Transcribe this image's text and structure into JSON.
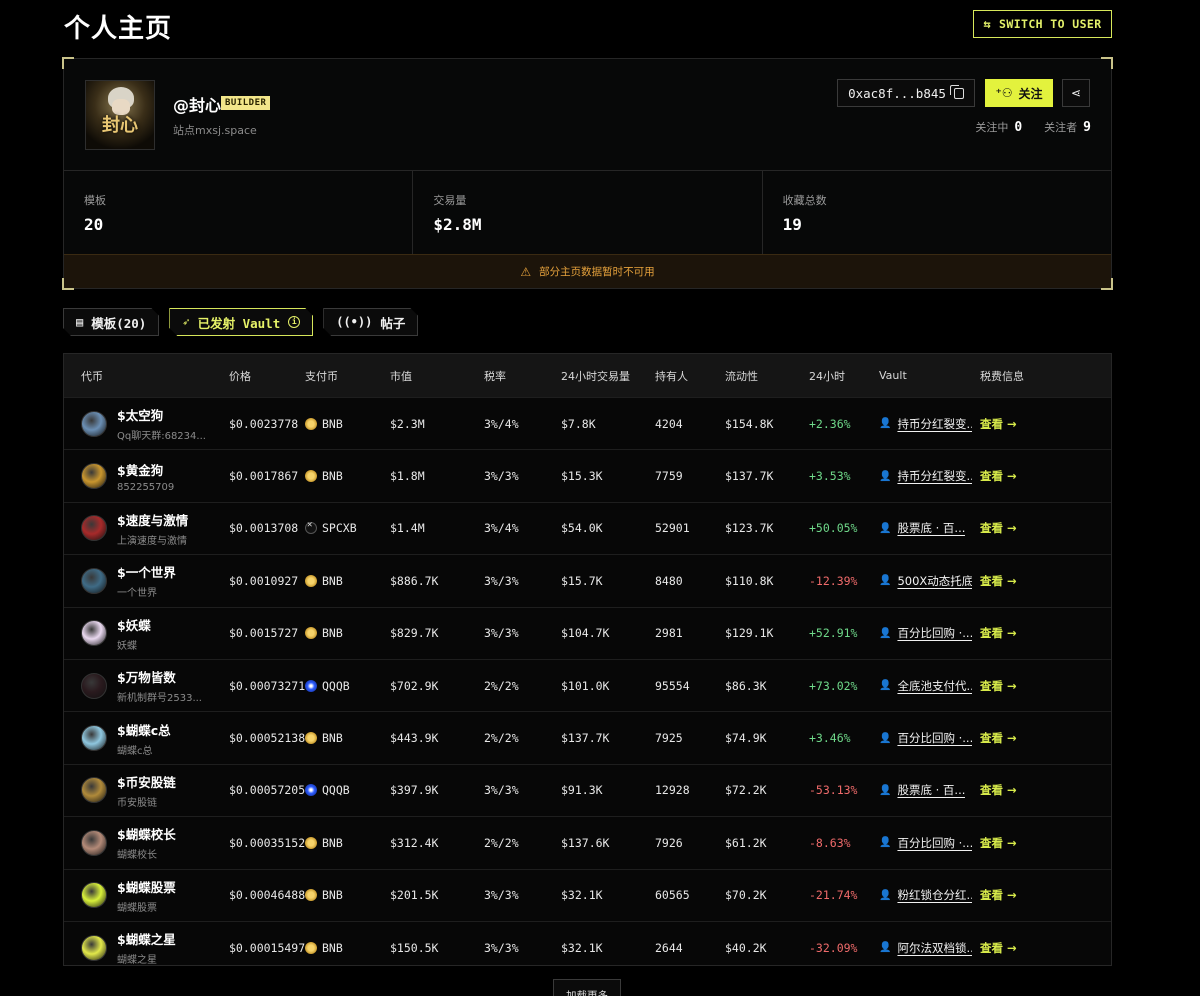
{
  "header": {
    "title": "个人主页",
    "switch_label": "SWITCH TO USER"
  },
  "profile": {
    "avatar_text": "封心",
    "username": "@封心",
    "badge": "BUILDER",
    "site": "站点mxsj.space",
    "address": "0xac8f...b845",
    "follow_label": "关注",
    "following_label": "关注中",
    "following_count": "0",
    "followers_label": "关注者",
    "followers_count": "9"
  },
  "stats": [
    {
      "label": "模板",
      "value": "20"
    },
    {
      "label": "交易量",
      "value": "$2.8M"
    },
    {
      "label": "收藏总数",
      "value": "19"
    }
  ],
  "warning": "部分主页数据暂时不可用",
  "tabs": [
    {
      "label": "模板(20)"
    },
    {
      "label": "已发射 Vault"
    },
    {
      "label": "帖子"
    }
  ],
  "table": {
    "headers": [
      "代币",
      "价格",
      "支付币",
      "市值",
      "税率",
      "24小时交易量",
      "持有人",
      "流动性",
      "24小时",
      "Vault",
      "税费信息"
    ],
    "view_label": "查看 →",
    "rows": [
      {
        "name": "$太空狗",
        "sub": "Qq聊天群:68234...",
        "price": "$0.0023778",
        "pay": "BNB",
        "coin": "bnb",
        "mcap": "$2.3M",
        "tax": "3%/4%",
        "vol": "$7.8K",
        "holders": "4204",
        "liq": "$154.8K",
        "chg": "+2.36%",
        "dir": "up",
        "vault": "持币分红裂变...",
        "icon": "#6b8fb4"
      },
      {
        "name": "$黄金狗",
        "sub": "852255709",
        "price": "$0.0017867",
        "pay": "BNB",
        "coin": "bnb",
        "mcap": "$1.8M",
        "tax": "3%/3%",
        "vol": "$15.3K",
        "holders": "7759",
        "liq": "$137.7K",
        "chg": "+3.53%",
        "dir": "up",
        "vault": "持币分红裂变...",
        "icon": "#c9962e"
      },
      {
        "name": "$速度与激情",
        "sub": "上演速度与激情",
        "price": "$0.0013708",
        "pay": "SPCXB",
        "coin": "spcxb",
        "mcap": "$1.4M",
        "tax": "3%/4%",
        "vol": "$54.0K",
        "holders": "52901",
        "liq": "$123.7K",
        "chg": "+50.05%",
        "dir": "up",
        "vault": "股票底 · 百...",
        "icon": "#a82a2a"
      },
      {
        "name": "$一个世界",
        "sub": "一个世界",
        "price": "$0.0010927",
        "pay": "BNB",
        "coin": "bnb",
        "mcap": "$886.7K",
        "tax": "3%/3%",
        "vol": "$15.7K",
        "holders": "8480",
        "liq": "$110.8K",
        "chg": "-12.39%",
        "dir": "down",
        "vault": "500X动态托底...",
        "icon": "#3f6b86"
      },
      {
        "name": "$妖蝶",
        "sub": "妖蝶",
        "price": "$0.0015727",
        "pay": "BNB",
        "coin": "bnb",
        "mcap": "$829.7K",
        "tax": "3%/3%",
        "vol": "$104.7K",
        "holders": "2981",
        "liq": "$129.1K",
        "chg": "+52.91%",
        "dir": "up",
        "vault": "百分比回购 ·...",
        "icon": "#e9d8ef"
      },
      {
        "name": "$万物皆数",
        "sub": "新机制群号2533...",
        "price": "$0.00073271",
        "pay": "QQQB",
        "coin": "qqqb",
        "mcap": "$702.9K",
        "tax": "2%/2%",
        "vol": "$101.0K",
        "holders": "95554",
        "liq": "$86.3K",
        "chg": "+73.02%",
        "dir": "up",
        "vault": "全底池支付代...",
        "icon": "#2a1a1e"
      },
      {
        "name": "$蝴蝶c总",
        "sub": "蝴蝶c总",
        "price": "$0.00052138",
        "pay": "BNB",
        "coin": "bnb",
        "mcap": "$443.9K",
        "tax": "2%/2%",
        "vol": "$137.7K",
        "holders": "7925",
        "liq": "$74.9K",
        "chg": "+3.46%",
        "dir": "up",
        "vault": "百分比回购 ·...",
        "icon": "#8fc7df"
      },
      {
        "name": "$币安股链",
        "sub": "币安股链",
        "price": "$0.00057205",
        "pay": "QQQB",
        "coin": "qqqb",
        "mcap": "$397.9K",
        "tax": "3%/3%",
        "vol": "$91.3K",
        "holders": "12928",
        "liq": "$72.2K",
        "chg": "-53.13%",
        "dir": "down",
        "vault": "股票底 · 百...",
        "icon": "#b08a3a"
      },
      {
        "name": "$蝴蝶校长",
        "sub": "蝴蝶校长",
        "price": "$0.00035152",
        "pay": "BNB",
        "coin": "bnb",
        "mcap": "$312.4K",
        "tax": "2%/2%",
        "vol": "$137.6K",
        "holders": "7926",
        "liq": "$61.2K",
        "chg": "-8.63%",
        "dir": "down",
        "vault": "百分比回购 ·...",
        "icon": "#b38a78"
      },
      {
        "name": "$蝴蝶股票",
        "sub": "蝴蝶股票",
        "price": "$0.00046488",
        "pay": "BNB",
        "coin": "bnb",
        "mcap": "$201.5K",
        "tax": "3%/3%",
        "vol": "$32.1K",
        "holders": "60565",
        "liq": "$70.2K",
        "chg": "-21.74%",
        "dir": "down",
        "vault": "粉红锁仓分红...",
        "icon": "#d8f03a"
      },
      {
        "name": "$蝴蝶之星",
        "sub": "蝴蝶之星",
        "price": "$0.00015497",
        "pay": "BNB",
        "coin": "bnb",
        "mcap": "$150.5K",
        "tax": "3%/3%",
        "vol": "$32.1K",
        "holders": "2644",
        "liq": "$40.2K",
        "chg": "-32.09%",
        "dir": "down",
        "vault": "阿尔法双档锁...",
        "icon": "#e2e84a"
      }
    ]
  },
  "load_more": "加载更多"
}
